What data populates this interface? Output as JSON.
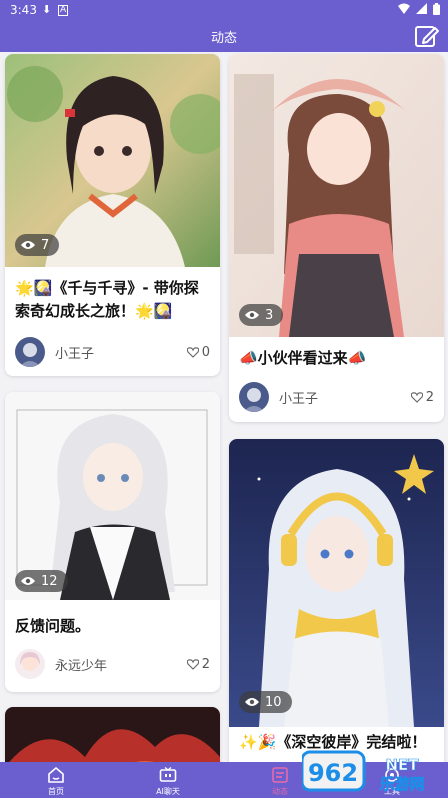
{
  "status_bar": {
    "time": "3:43"
  },
  "app_bar": {
    "title": "动态"
  },
  "posts": [
    {
      "views": "7",
      "title": "🌟🎑《千与千寻》- 带你探索奇幻成长之旅！🌟🎑",
      "author": "小王子",
      "likes": "0"
    },
    {
      "views": "3",
      "title": "📣小伙伴看过来📣",
      "author": "小王子",
      "likes": "2"
    },
    {
      "views": "12",
      "title": "反馈问题。",
      "author": "永远少年",
      "likes": "2"
    },
    {
      "views": "10",
      "title": "✨🎉《深空彼岸》完结啦！",
      "author": "",
      "likes": ""
    }
  ],
  "nav": [
    {
      "label": "首页",
      "icon": "home-icon"
    },
    {
      "label": "AI聊天",
      "icon": "tv-icon"
    },
    {
      "label": "动态",
      "icon": "feed-icon",
      "active": true
    },
    {
      "label": "工具",
      "icon": "tool-icon"
    }
  ],
  "watermark": {
    "text": "962",
    "sub": "乐游网",
    "domain": "NET"
  },
  "colors": {
    "primary": "#6b5fcf",
    "active_nav": "#e86aa8"
  }
}
